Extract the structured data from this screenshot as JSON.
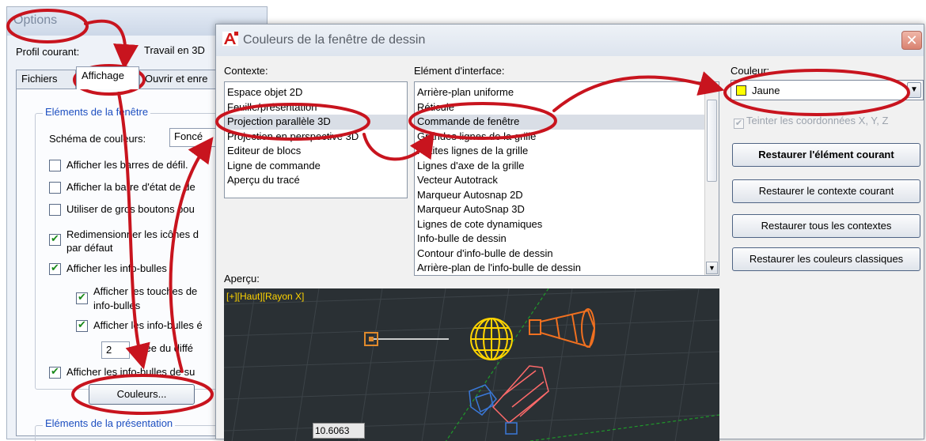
{
  "options_window": {
    "title": "Options",
    "profile_label": "Profil courant:",
    "profile_value": "Travail en 3D",
    "tabs": [
      "Fichiers",
      "Affichage",
      "Ouvrir et enre"
    ],
    "group_window_title": "Eléments de la fenêtre",
    "scheme_label": "Schéma de couleurs:",
    "scheme_value": "Foncé",
    "checkboxes": [
      {
        "label": "Afficher les barres de défil.",
        "checked": false
      },
      {
        "label": "Afficher la barre d'état de de",
        "checked": false
      },
      {
        "label": "Utiliser de gros boutons pou",
        "checked": false
      },
      {
        "label": "Redimensionner les icônes d",
        "label2": "par défaut",
        "checked": true
      },
      {
        "label": "Afficher les info-bulles",
        "checked": true
      },
      {
        "label": "Afficher les touches de",
        "label2": "info-bulles",
        "checked": true
      },
      {
        "label": "Afficher les info-bulles é",
        "checked": true
      },
      {
        "label": "Afficher les info-bulles de su",
        "checked": true
      }
    ],
    "delay_value": "2",
    "delay_label": "urée du diffé",
    "colors_button": "Couleurs...",
    "group_layout_title": "Eléments de la présentation"
  },
  "dialog": {
    "title": "Couleurs de la fenêtre de dessin",
    "close_glyph": "✕",
    "context_label": "Contexte:",
    "context_items": [
      "Espace objet 2D",
      "Feuille/présentation",
      "Projection parallèle 3D",
      "Projection en perspective 3D",
      "Editeur de blocs",
      "Ligne de commande",
      "Aperçu du tracé"
    ],
    "context_selected": 2,
    "element_label": "Elément d'interface:",
    "element_items": [
      "Arrière-plan uniforme",
      "Réticule",
      "Commande de fenêtre",
      "Grandes lignes de la grille",
      "Petites lignes de la grille",
      "Lignes d'axe de la grille",
      "Vecteur Autotrack",
      "Marqueur Autosnap 2D",
      "Marqueur AutoSnap 3D",
      "Lignes de cote dynamiques",
      "Info-bulle de dessin",
      "Contour d'info-bulle de dessin",
      "Arrière-plan de l'info-bulle de dessin"
    ],
    "element_selected": 2,
    "color_label": "Couleur:",
    "color_value": "Jaune",
    "color_swatch": "#ffff00",
    "tint_label": "Teinter les coordonnées X, Y, Z",
    "buttons": [
      "Restaurer l'élément courant",
      "Restaurer le contexte courant",
      "Restaurer tous les contextes",
      "Restaurer les couleurs classiques"
    ],
    "preview_label": "Aperçu:",
    "viewport_label": "[+][Haut][Rayon X]",
    "coord_value": "10.6063"
  },
  "colors": {
    "annotation": "#c8141e",
    "viewport_label": "#ffd400",
    "preview_bg": "#2a3034"
  }
}
